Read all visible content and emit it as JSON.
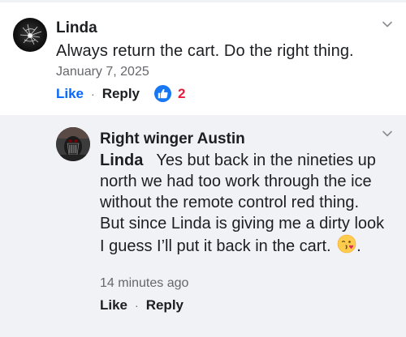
{
  "comment": {
    "author": "Linda",
    "text": "Always return the cart. Do the right thing.",
    "date": "January 7, 2025",
    "like_label": "Like",
    "separator": "·",
    "reply_label": "Reply",
    "reaction_count": "2",
    "reaction_icon": "thumbs-up-icon",
    "options_icon": "chevron-down-icon"
  },
  "reply": {
    "author": "Right winger Austin",
    "mention": "Linda",
    "text": "Yes but back in the nineties up north we had too work through the ice without the remote control red thing.  But since Linda is giving me a dirty look I guess I’ll put it back in the cart.",
    "emoji": "kissing-face-emoji",
    "text_end": ".",
    "time": "14 minutes ago",
    "like_label": "Like",
    "separator": "·",
    "reply_label": "Reply",
    "options_icon": "chevron-down-icon"
  },
  "colors": {
    "link_blue": "#0866ff",
    "reaction_red": "#e41e3f",
    "muted_gray": "#65676b",
    "reply_bg": "#f0f2f5"
  }
}
